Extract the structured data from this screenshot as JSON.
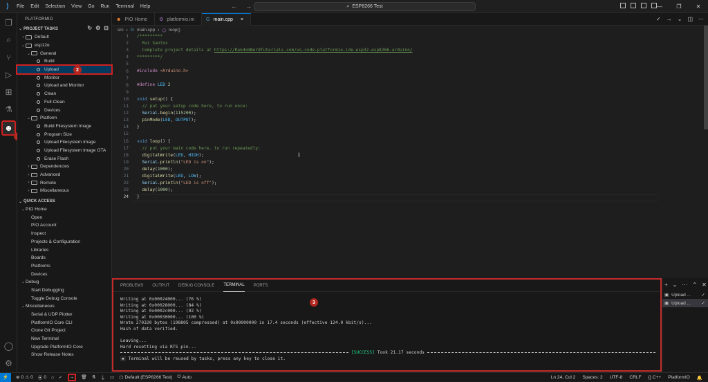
{
  "titlebar": {
    "menu": [
      "File",
      "Edit",
      "Selection",
      "View",
      "Go",
      "Run",
      "Terminal",
      "Help"
    ],
    "search": "ESP8266 Test"
  },
  "activitybar": {
    "icons": [
      "explorer-icon",
      "search-icon",
      "source-control-icon",
      "run-debug-icon",
      "extensions-icon",
      "testing-icon",
      "platformio-icon",
      "account-icon",
      "settings-icon"
    ],
    "badge_1": "1",
    "badge_2": "2",
    "badge_3": "3"
  },
  "sidebar": {
    "title": "PLATFORMIO",
    "project_tasks": "PROJECT TASKS",
    "tree": [
      {
        "label": "Default",
        "level": 0,
        "kind": "folder-collapsed"
      },
      {
        "label": "esp12e",
        "level": 0,
        "kind": "folder-open"
      },
      {
        "label": "General",
        "level": 1,
        "kind": "folder-open"
      },
      {
        "label": "Build",
        "level": 2,
        "kind": "task"
      },
      {
        "label": "Upload",
        "level": 2,
        "kind": "task",
        "selected": true
      },
      {
        "label": "Monitor",
        "level": 2,
        "kind": "task"
      },
      {
        "label": "Upload and Monitor",
        "level": 2,
        "kind": "task"
      },
      {
        "label": "Clean",
        "level": 2,
        "kind": "task"
      },
      {
        "label": "Full Clean",
        "level": 2,
        "kind": "task"
      },
      {
        "label": "Devices",
        "level": 2,
        "kind": "task"
      },
      {
        "label": "Platform",
        "level": 1,
        "kind": "folder-open"
      },
      {
        "label": "Build Filesystem Image",
        "level": 2,
        "kind": "task"
      },
      {
        "label": "Program Size",
        "level": 2,
        "kind": "task"
      },
      {
        "label": "Upload Filesystem Image",
        "level": 2,
        "kind": "task"
      },
      {
        "label": "Upload Filesystem Image OTA",
        "level": 2,
        "kind": "task"
      },
      {
        "label": "Erase Flash",
        "level": 2,
        "kind": "task"
      },
      {
        "label": "Dependencies",
        "level": 1,
        "kind": "folder-collapsed"
      },
      {
        "label": "Advanced",
        "level": 1,
        "kind": "folder-collapsed"
      },
      {
        "label": "Remote",
        "level": 1,
        "kind": "folder-collapsed"
      },
      {
        "label": "Miscellaneous",
        "level": 1,
        "kind": "folder-collapsed"
      }
    ],
    "quick_access": "QUICK ACCESS",
    "quick_tree": [
      {
        "label": "PIO Home",
        "level": 0,
        "kind": "group"
      },
      {
        "label": "Open",
        "level": 1,
        "kind": "item"
      },
      {
        "label": "PIO Account",
        "level": 1,
        "kind": "item"
      },
      {
        "label": "Inspect",
        "level": 1,
        "kind": "item"
      },
      {
        "label": "Projects & Configuration",
        "level": 1,
        "kind": "item"
      },
      {
        "label": "Libraries",
        "level": 1,
        "kind": "item"
      },
      {
        "label": "Boards",
        "level": 1,
        "kind": "item"
      },
      {
        "label": "Platforms",
        "level": 1,
        "kind": "item"
      },
      {
        "label": "Devices",
        "level": 1,
        "kind": "item"
      },
      {
        "label": "Debug",
        "level": 0,
        "kind": "group"
      },
      {
        "label": "Start Debugging",
        "level": 1,
        "kind": "item"
      },
      {
        "label": "Toggle Debug Console",
        "level": 1,
        "kind": "item"
      },
      {
        "label": "Miscellaneous",
        "level": 0,
        "kind": "group"
      },
      {
        "label": "Serial & UDP Plotter",
        "level": 1,
        "kind": "item"
      },
      {
        "label": "PlatformIO Core CLI",
        "level": 1,
        "kind": "item"
      },
      {
        "label": "Clone Git Project",
        "level": 1,
        "kind": "item"
      },
      {
        "label": "New Terminal",
        "level": 1,
        "kind": "item"
      },
      {
        "label": "Upgrade PlatformIO Core",
        "level": 1,
        "kind": "item"
      },
      {
        "label": "Show Release Notes",
        "level": 1,
        "kind": "item"
      }
    ]
  },
  "tabs": [
    {
      "label": "PIO Home",
      "icon": "platformio-icon"
    },
    {
      "label": "platformio.ini",
      "icon": "ini-file-icon"
    },
    {
      "label": "main.cpp",
      "icon": "cpp-file-icon",
      "active": true,
      "close": "×"
    }
  ],
  "breadcrumb": {
    "folder": "src",
    "file": "main.cpp",
    "symbol": "loop()"
  },
  "code": {
    "current_line": 24,
    "lines": [
      "1",
      "2",
      "3",
      "4",
      "5",
      "6",
      "7",
      "8",
      "9",
      "10",
      "11",
      "12",
      "13",
      "14",
      "15",
      "16",
      "17",
      "18",
      "19",
      "20",
      "21",
      "22",
      "23",
      "24"
    ]
  },
  "panel": {
    "tabs": [
      "PROBLEMS",
      "OUTPUT",
      "DEBUG CONSOLE",
      "TERMINAL",
      "PORTS"
    ],
    "active_tab": "TERMINAL",
    "terminal": [
      "Writing at 0x00024000... (76 %)",
      "Writing at 0x00028000... (84 %)",
      "Writing at 0x0002c000... (92 %)",
      "Writing at 0x00030000... (100 %)",
      "Wrote 270320 bytes (198805 compressed) at 0x00000000 in 17.4 seconds (effective 124.0 kbit/s)...",
      "Hash of data verified.",
      "",
      "Leaving...",
      "Hard resetting via RTS pin..."
    ],
    "success_label": "[SUCCESS]",
    "success_time": "Took 21.17 seconds",
    "reuse_note": "Terminal will be reused by tasks, press any key to close it.",
    "instances": [
      "Upload ...",
      "Upload ..."
    ]
  },
  "statusbar": {
    "errors": "0",
    "warnings": "0",
    "ports": "0",
    "home": "⌂",
    "env": "Default (ESP8266 Test)",
    "auto": "Auto",
    "position": "Ln 24, Col 2",
    "spaces": "Spaces: 2",
    "encoding": "UTF-8",
    "eol": "CRLF",
    "lang": "C++",
    "ext": "PlatformIO"
  }
}
